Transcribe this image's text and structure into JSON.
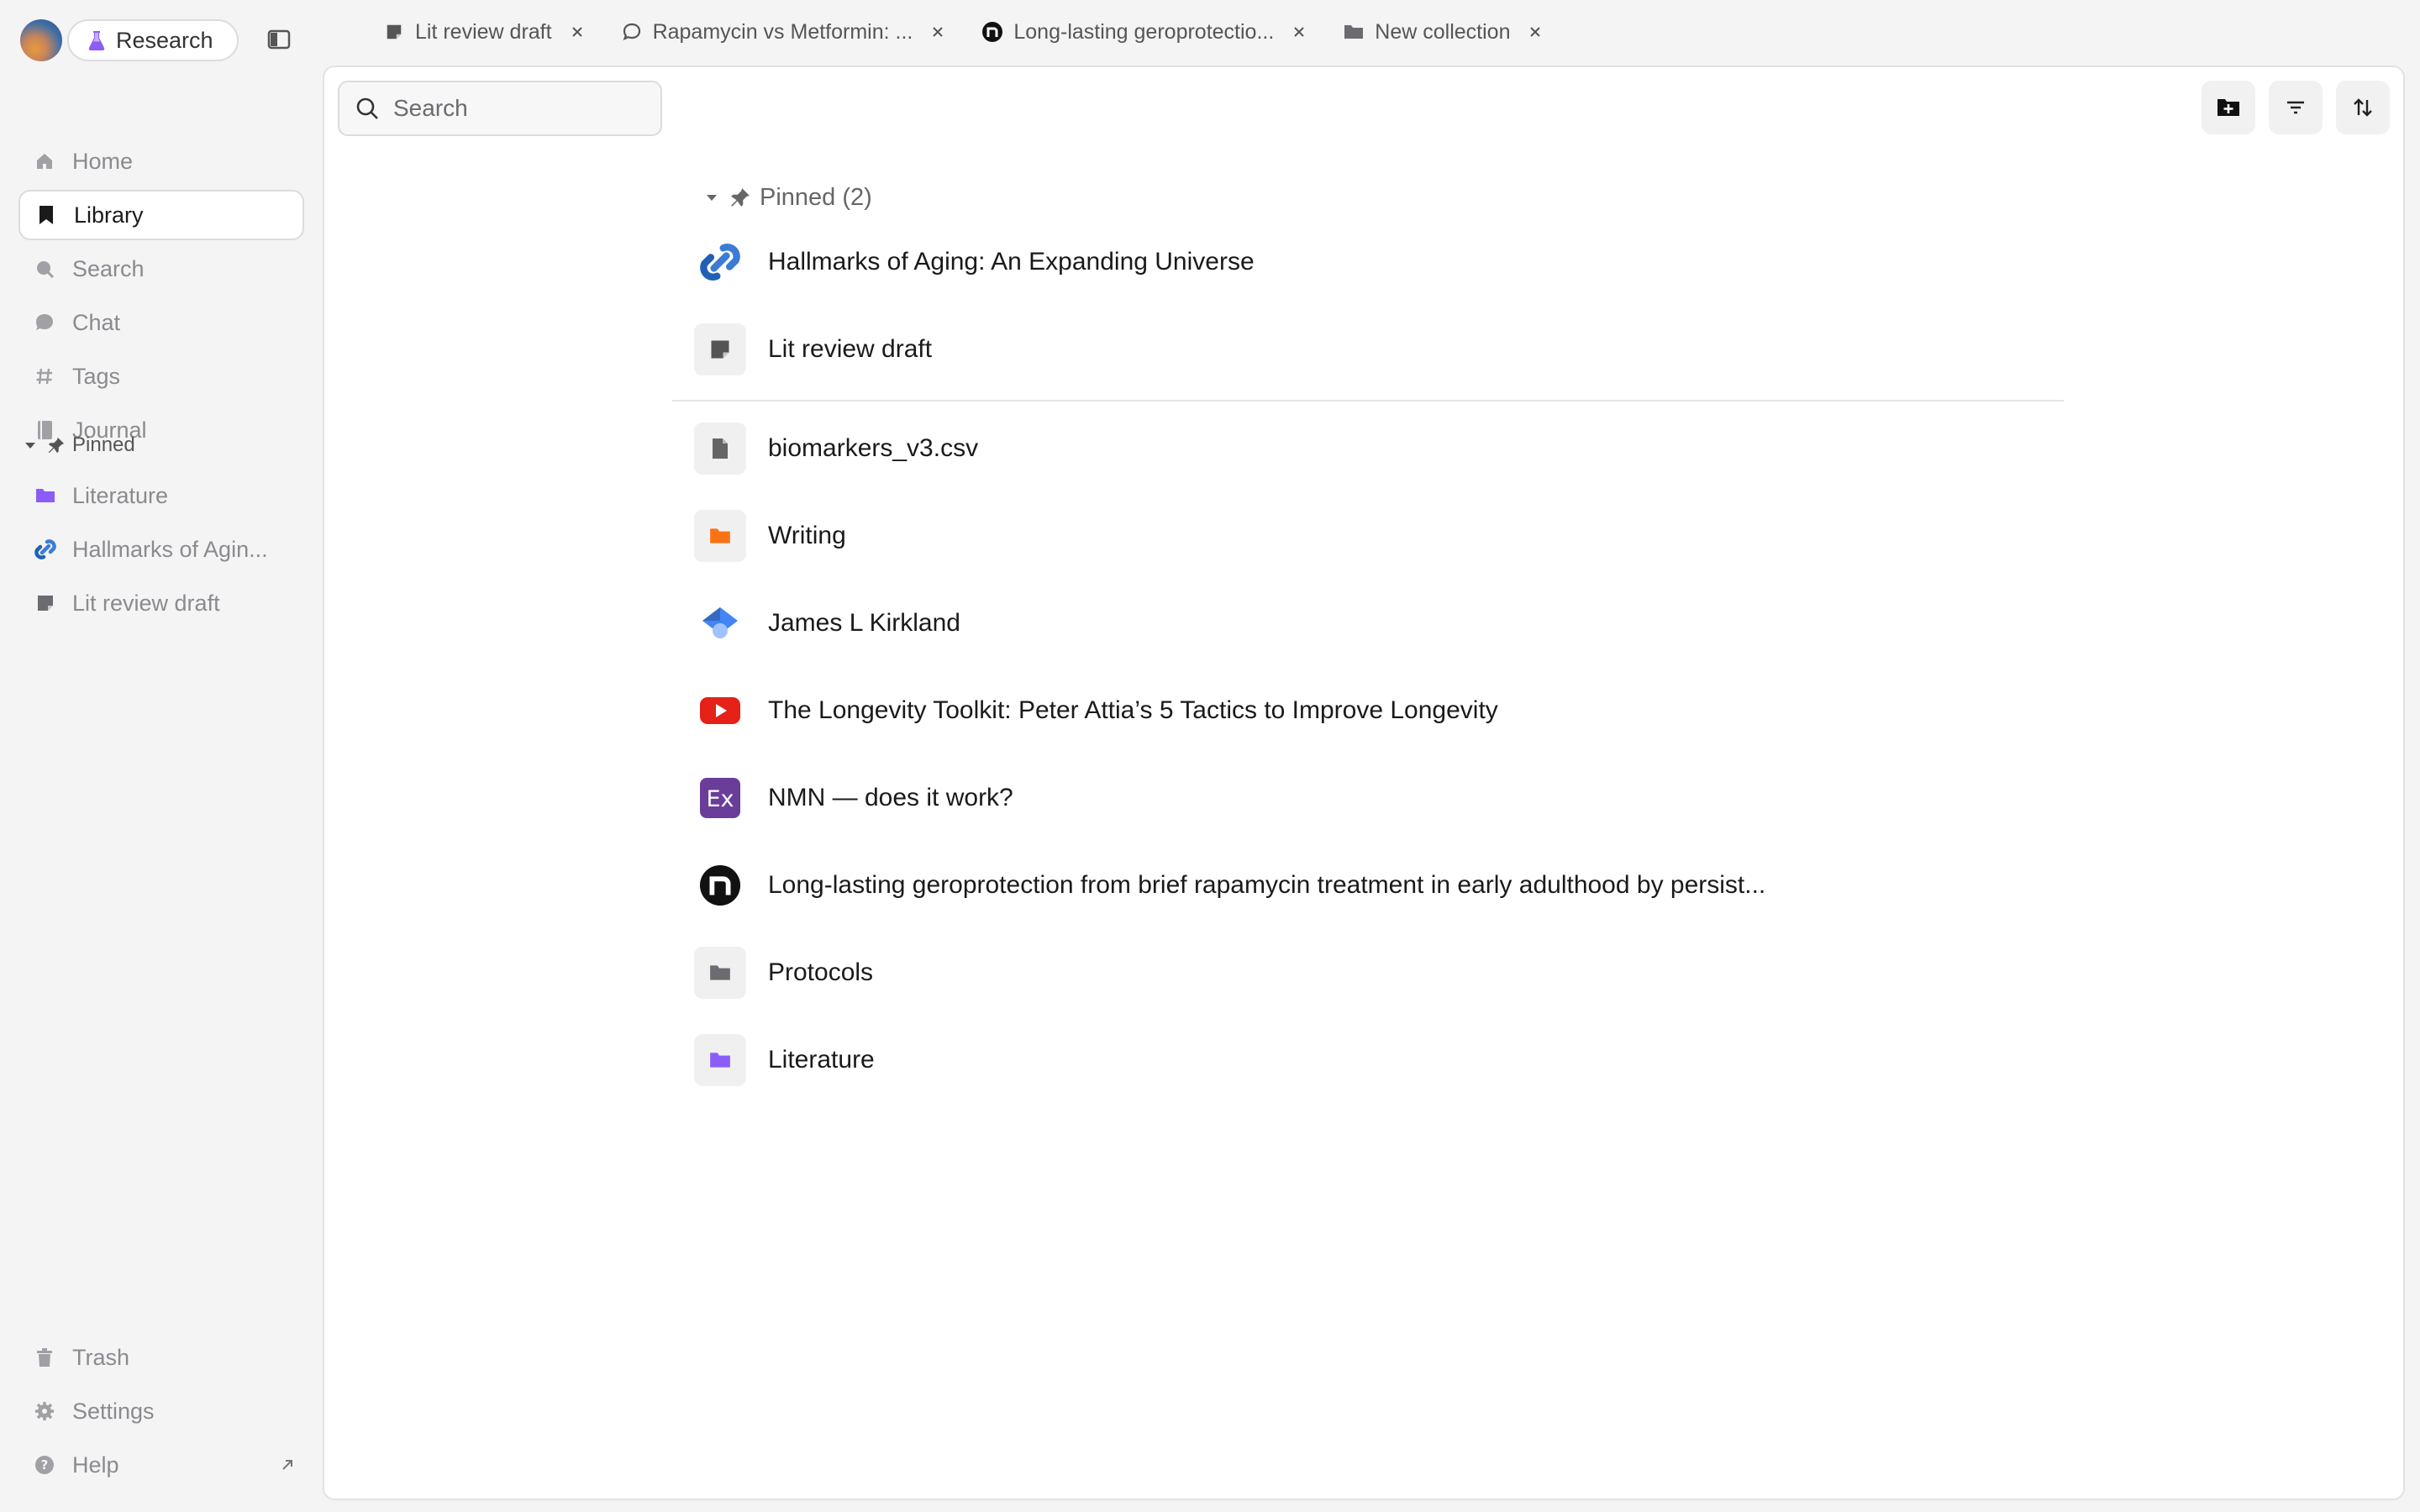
{
  "workspace": {
    "name": "Research"
  },
  "nav": {
    "items": [
      {
        "label": "Home",
        "icon": "home-icon"
      },
      {
        "label": "Library",
        "icon": "bookmark-icon",
        "active": true
      },
      {
        "label": "Search",
        "icon": "search-icon"
      },
      {
        "label": "Chat",
        "icon": "chat-icon"
      },
      {
        "label": "Tags",
        "icon": "hash-icon"
      },
      {
        "label": "Journal",
        "icon": "journal-icon"
      }
    ],
    "pinned_title": "Pinned",
    "pinned": [
      {
        "label": "Literature",
        "icon": "folder-icon",
        "color": "#8b5cf6"
      },
      {
        "label": "Hallmarks of Agin...",
        "icon": "link-icon"
      },
      {
        "label": "Lit review draft",
        "icon": "note-icon"
      }
    ],
    "bottom": [
      {
        "label": "Trash",
        "icon": "trash-icon"
      },
      {
        "label": "Settings",
        "icon": "gear-icon"
      },
      {
        "label": "Help",
        "icon": "help-icon"
      }
    ]
  },
  "tabs": [
    {
      "label": "Lit review draft",
      "icon": "note-icon"
    },
    {
      "label": "Rapamycin vs Metformin: ...",
      "icon": "chat-icon"
    },
    {
      "label": "Long-lasting geroprotectio...",
      "icon": "n-logo-icon"
    },
    {
      "label": "New collection",
      "icon": "folder-icon"
    }
  ],
  "main": {
    "search_placeholder": "Search",
    "pinned_group_label": "Pinned (2)",
    "pinned_items": [
      {
        "label": "Hallmarks of Aging: An Expanding Universe",
        "icon": "link-icon"
      },
      {
        "label": "Lit review draft",
        "icon": "note-icon"
      }
    ],
    "items": [
      {
        "label": "biomarkers_v3.csv",
        "icon": "file-icon"
      },
      {
        "label": "Writing",
        "icon": "folder-icon",
        "color": "#f97316"
      },
      {
        "label": "James L Kirkland",
        "icon": "scholar-cap-icon"
      },
      {
        "label": "The Longevity Toolkit: Peter Attia’s 5 Tactics to Improve Longevity",
        "icon": "youtube-icon"
      },
      {
        "label": "NMN — does it work?",
        "icon": "ex-logo-icon"
      },
      {
        "label": "Long-lasting geroprotection from brief rapamycin treatment in early adulthood by persist...",
        "icon": "n-logo-icon"
      },
      {
        "label": "Protocols",
        "icon": "folder-icon",
        "color": "#6b6b70"
      },
      {
        "label": "Literature",
        "icon": "folder-icon",
        "color": "#8b5cf6"
      }
    ]
  },
  "colors": {
    "accent_purple": "#8b5cf6",
    "orange": "#f97316",
    "youtube_red": "#e62117",
    "ex_purple": "#6a3d9a"
  }
}
